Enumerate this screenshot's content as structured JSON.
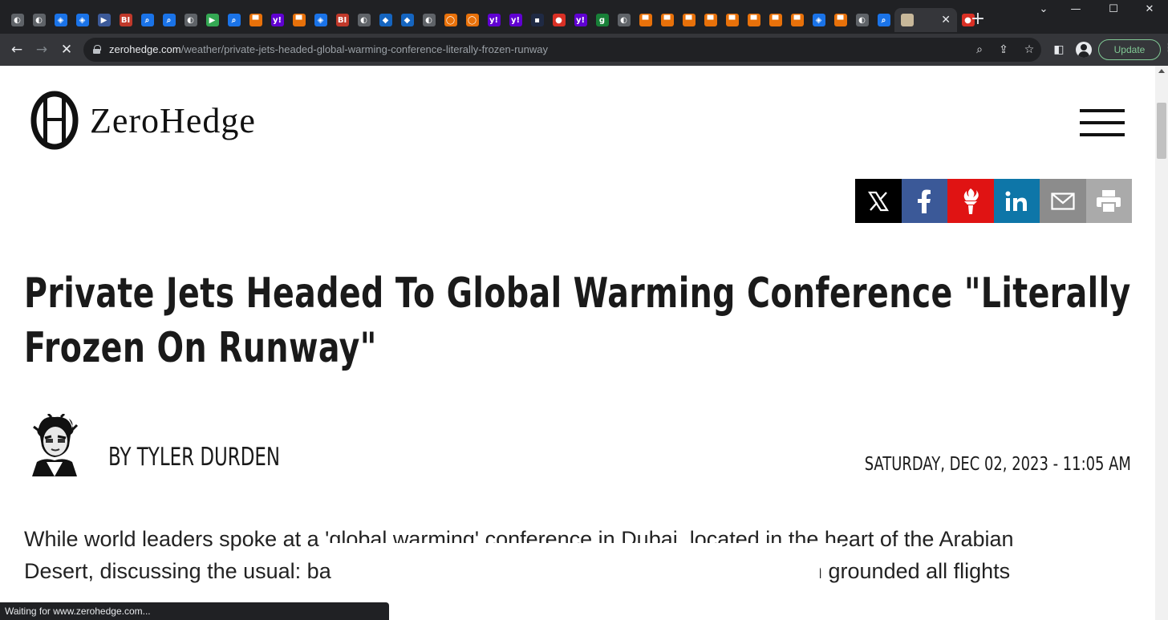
{
  "browser": {
    "tabs": [
      {
        "icon": "globe-icon",
        "glyph": "◐",
        "color": "#5f6368"
      },
      {
        "icon": "globe-icon",
        "glyph": "◐",
        "color": "#5f6368"
      },
      {
        "icon": "shield-icon",
        "glyph": "◈",
        "color": "#1a73e8"
      },
      {
        "icon": "shield-icon",
        "glyph": "◈",
        "color": "#1a73e8"
      },
      {
        "icon": "play-icon",
        "glyph": "▶",
        "color": "#3c5a99"
      },
      {
        "icon": "bi-icon",
        "glyph": "BI",
        "color": "#c0392b"
      },
      {
        "icon": "search-icon",
        "glyph": "⌕",
        "color": "#1a73e8"
      },
      {
        "icon": "search-icon",
        "glyph": "⌕",
        "color": "#1a73e8"
      },
      {
        "icon": "globe-icon",
        "glyph": "◐",
        "color": "#5f6368"
      },
      {
        "icon": "play-icon",
        "glyph": "▶",
        "color": "#34a853"
      },
      {
        "icon": "search-icon",
        "glyph": "⌕",
        "color": "#1a73e8"
      },
      {
        "icon": "bookmark-icon",
        "glyph": "▀",
        "color": "#e8710a"
      },
      {
        "icon": "yahoo-icon",
        "glyph": "y!",
        "color": "#6001d2"
      },
      {
        "icon": "bookmark-icon",
        "glyph": "▀",
        "color": "#e8710a"
      },
      {
        "icon": "shield-icon",
        "glyph": "◈",
        "color": "#1a73e8"
      },
      {
        "icon": "bi-icon",
        "glyph": "BI",
        "color": "#c0392b"
      },
      {
        "icon": "globe-icon",
        "glyph": "◐",
        "color": "#5f6368"
      },
      {
        "icon": "cube-icon",
        "glyph": "◆",
        "color": "#1565c0"
      },
      {
        "icon": "cube-icon",
        "glyph": "◆",
        "color": "#1565c0"
      },
      {
        "icon": "globe-icon",
        "glyph": "◐",
        "color": "#5f6368"
      },
      {
        "icon": "badge-icon",
        "glyph": "◯",
        "color": "#e8710a"
      },
      {
        "icon": "badge-icon",
        "glyph": "◯",
        "color": "#e8710a"
      },
      {
        "icon": "yahoo-icon",
        "glyph": "y!",
        "color": "#6001d2"
      },
      {
        "icon": "yahoo-icon",
        "glyph": "y!",
        "color": "#6001d2"
      },
      {
        "icon": "news-icon",
        "glyph": "▪",
        "color": "#1f2a44"
      },
      {
        "icon": "mic-icon",
        "glyph": "●",
        "color": "#d93025"
      },
      {
        "icon": "yahoo-icon",
        "glyph": "y!",
        "color": "#6001d2"
      },
      {
        "icon": "g-icon",
        "glyph": "g",
        "color": "#188038"
      },
      {
        "icon": "globe-icon",
        "glyph": "◐",
        "color": "#5f6368"
      },
      {
        "icon": "bookmark-icon",
        "glyph": "▀",
        "color": "#e8710a"
      },
      {
        "icon": "bookmark-icon",
        "glyph": "▀",
        "color": "#e8710a"
      },
      {
        "icon": "bookmark-icon",
        "glyph": "▀",
        "color": "#e8710a"
      },
      {
        "icon": "bookmark-icon",
        "glyph": "▀",
        "color": "#e8710a"
      },
      {
        "icon": "bookmark-icon",
        "glyph": "▀",
        "color": "#e8710a"
      },
      {
        "icon": "bookmark-icon",
        "glyph": "▀",
        "color": "#e8710a"
      },
      {
        "icon": "bookmark-icon",
        "glyph": "▀",
        "color": "#e8710a"
      },
      {
        "icon": "bookmark-icon",
        "glyph": "▀",
        "color": "#e8710a"
      },
      {
        "icon": "shield-icon",
        "glyph": "◈",
        "color": "#1a73e8"
      },
      {
        "icon": "bookmark-icon",
        "glyph": "▀",
        "color": "#e8710a"
      },
      {
        "icon": "globe-icon",
        "glyph": "◐",
        "color": "#5f6368"
      },
      {
        "icon": "search-icon",
        "glyph": "⌕",
        "color": "#1a73e8"
      }
    ],
    "active_tab": {
      "icon": "zerohedge-favicon",
      "close": "✕"
    },
    "trailing_tab": {
      "icon": "mic-icon",
      "glyph": "●",
      "color": "#d93025"
    },
    "new_tab": "+",
    "window": {
      "minimize": "⌄",
      "minimize2": "—",
      "maximize": "☐",
      "close": "✕"
    },
    "address": {
      "host": "zerohedge.com",
      "path": "/weather/private-jets-headed-global-warming-conference-literally-frozen-runway"
    },
    "update_label": "Update",
    "status_text": "Waiting for www.zerohedge.com..."
  },
  "site": {
    "logo_text": "ZeroHedge"
  },
  "share": [
    {
      "name": "x-share-button",
      "icon": "x-icon",
      "color": "#000000"
    },
    {
      "name": "facebook-share-button",
      "icon": "facebook-icon",
      "color": "#3b5998"
    },
    {
      "name": "torch-share-button",
      "icon": "torch-icon",
      "color": "#e01313"
    },
    {
      "name": "linkedin-share-button",
      "icon": "linkedin-icon",
      "color": "#0e76a8"
    },
    {
      "name": "email-share-button",
      "icon": "email-icon",
      "color": "#8c8c8c"
    },
    {
      "name": "print-share-button",
      "icon": "print-icon",
      "color": "#aaaaaa"
    }
  ],
  "article": {
    "headline": "Private Jets Headed To Global Warming Conference \"Literally Frozen On Runway\"",
    "byline": "BY TYLER DURDEN",
    "date": "SATURDAY, DEC 02, 2023 - 11:05 AM",
    "body": "While world leaders spoke at a 'global warming' conference in Dubai, located in the heart of the Arabian Desert, discussing the usual: banning gas-powered vehicles, a powerful snowstorm grounded all flights"
  }
}
